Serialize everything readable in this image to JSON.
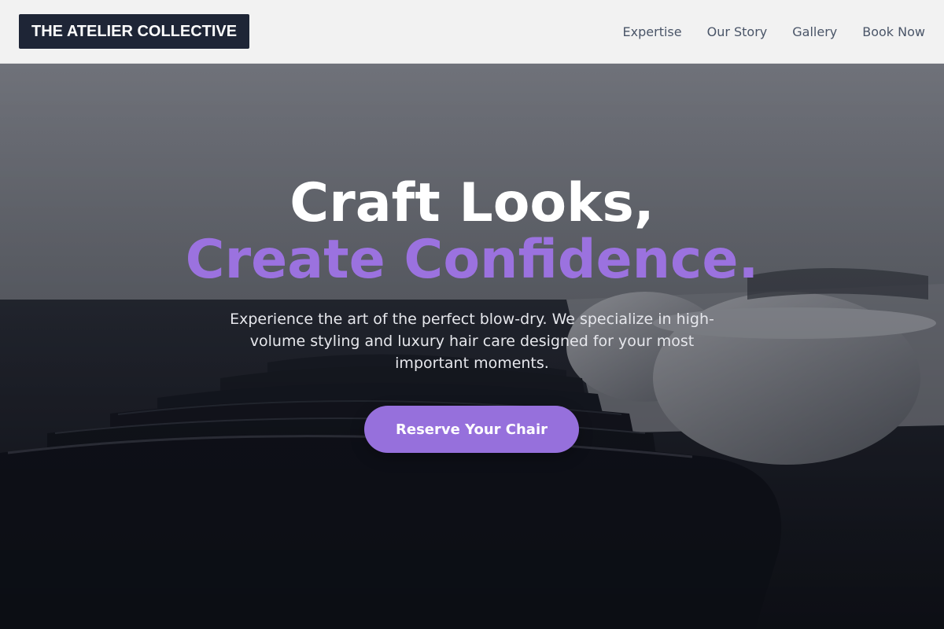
{
  "header": {
    "logo_text": "THE ATELIER COLLECTIVE",
    "nav": [
      {
        "label": "Expertise"
      },
      {
        "label": "Our Story"
      },
      {
        "label": "Gallery"
      },
      {
        "label": "Book Now"
      }
    ]
  },
  "hero": {
    "headline_line1": "Craft Looks,",
    "headline_line2": "Create Confidence.",
    "subtext": "Experience the art of the perfect blow-dry. We specialize in high-volume styling and luxury hair care designed for your most important moments.",
    "cta_label": "Reserve Your Chair",
    "background_image": "salon-shampoo-chairs"
  },
  "colors": {
    "accent": "#9b72df",
    "button": "#9670dc",
    "logo_bg": "#1e2536",
    "header_bg": "#f2f2f2",
    "nav_text": "#4a5568"
  }
}
